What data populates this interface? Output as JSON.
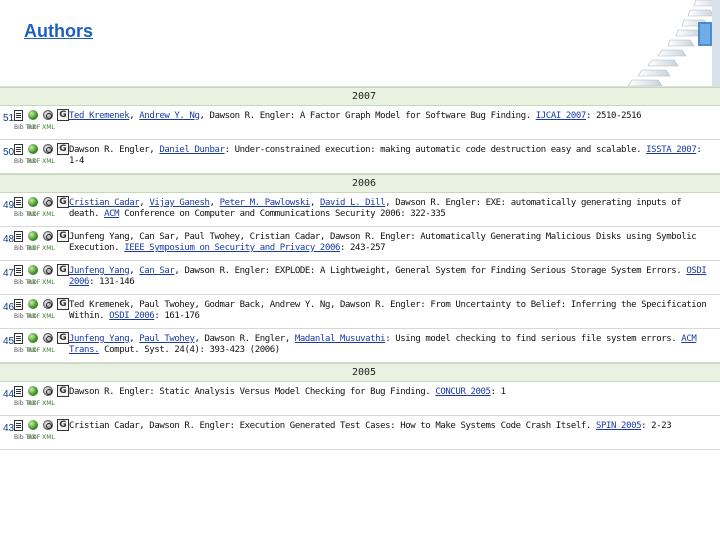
{
  "header": {
    "title": "Authors"
  },
  "years": [
    {
      "year": "2007",
      "entries": [
        {
          "num": "51",
          "bib": "Bib TeX",
          "rdf": "RDF XML",
          "parts": [
            {
              "t": "Ted Kremenek",
              "link": true
            },
            {
              "t": ", "
            },
            {
              "t": "Andrew Y. Ng",
              "link": true
            },
            {
              "t": ", Dawson R. Engler: A Factor Graph Model for Software Bug Finding. "
            },
            {
              "t": "IJCAI 2007",
              "link": true
            },
            {
              "t": ": 2510-2516"
            }
          ]
        },
        {
          "num": "50",
          "bib": "Bib TeX",
          "rdf": "RDF XML",
          "parts": [
            {
              "t": "Dawson R. Engler, "
            },
            {
              "t": "Daniel Dunbar",
              "link": true
            },
            {
              "t": ": Under-constrained execution: making automatic code destruction easy and scalable. "
            },
            {
              "t": "ISSTA 2007",
              "link": true
            },
            {
              "t": ": 1-4"
            }
          ]
        }
      ]
    },
    {
      "year": "2006",
      "entries": [
        {
          "num": "49",
          "bib": "Bib TeX",
          "rdf": "RDF XML",
          "parts": [
            {
              "t": "Cristian Cadar",
              "link": true
            },
            {
              "t": ", "
            },
            {
              "t": "Vijay Ganesh",
              "link": true
            },
            {
              "t": ", "
            },
            {
              "t": "Peter M. Pawlowski",
              "link": true
            },
            {
              "t": ", "
            },
            {
              "t": "David L. Dill",
              "link": true
            },
            {
              "t": ", Dawson R. Engler: EXE: automatically generating inputs of death. "
            },
            {
              "t": "ACM",
              "link": true
            },
            {
              "t": " Conference on Computer and Communications Security 2006: 322-335"
            }
          ]
        },
        {
          "num": "48",
          "bib": "Bib TeX",
          "rdf": "RDF XML",
          "parts": [
            {
              "t": "Junfeng Yang, Can Sar, Paul Twohey, Cristian Cadar, Dawson R. Engler: Automatically Generating Malicious Disks using Symbolic Execution. "
            },
            {
              "t": "IEEE Symposium on Security and Privacy 2006",
              "link": true
            },
            {
              "t": ": 243-257"
            }
          ]
        },
        {
          "num": "47",
          "bib": "Bib TeX",
          "rdf": "RDF XML",
          "parts": [
            {
              "t": "Junfeng Yang",
              "link": true
            },
            {
              "t": ", "
            },
            {
              "t": "Can Sar",
              "link": true
            },
            {
              "t": ", Dawson R. Engler: EXPLODE: A Lightweight, General System for Finding Serious Storage System Errors. "
            },
            {
              "t": "OSDI 2006",
              "link": true
            },
            {
              "t": ": 131-146"
            }
          ]
        },
        {
          "num": "46",
          "bib": "Bib TeX",
          "rdf": "RDF XML",
          "parts": [
            {
              "t": "Ted Kremenek, Paul Twohey, Godmar Back, Andrew Y. Ng, Dawson R. Engler: From Uncertainty to Belief: Inferring the Specification Within. "
            },
            {
              "t": "OSDI 2006",
              "link": true
            },
            {
              "t": ": 161-176"
            }
          ]
        },
        {
          "num": "45",
          "bib": "Bib TeX",
          "rdf": "RDF XML",
          "parts": [
            {
              "t": "Junfeng Yang",
              "link": true
            },
            {
              "t": ", "
            },
            {
              "t": "Paul Twohey",
              "link": true
            },
            {
              "t": ", Dawson R. Engler, "
            },
            {
              "t": "Madanlal Musuvathi",
              "link": true
            },
            {
              "t": ": Using model checking to find serious file system errors. "
            },
            {
              "t": "ACM Trans.",
              "link": true
            },
            {
              "t": " Comput. Syst. 24(4): 393-423 (2006)"
            }
          ]
        }
      ]
    },
    {
      "year": "2005",
      "entries": [
        {
          "num": "44",
          "bib": "Bib TeX",
          "rdf": "RDF XML",
          "parts": [
            {
              "t": "Dawson R. Engler: Static Analysis Versus Model Checking for Bug Finding. "
            },
            {
              "t": "CONCUR 2005",
              "link": true
            },
            {
              "t": ": 1"
            }
          ]
        },
        {
          "num": "43",
          "bib": "Bib TeX",
          "rdf": "RDF XML",
          "parts": [
            {
              "t": "Cristian Cadar, Dawson R. Engler: Execution Generated Test Cases: How to Make Systems Code Crash Itself. "
            },
            {
              "t": "SPIN 2005",
              "link": true
            },
            {
              "t": ": 2-23"
            }
          ]
        }
      ]
    }
  ]
}
